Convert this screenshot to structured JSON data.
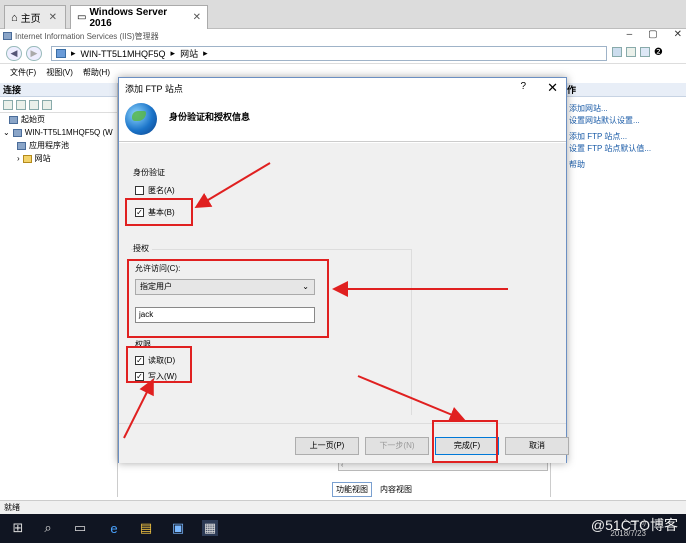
{
  "browser_tabs": [
    {
      "label": "主页",
      "active": false
    },
    {
      "label": "Windows Server 2016",
      "active": true
    }
  ],
  "iis": {
    "window_title": "Internet Information Services (IIS)管理器",
    "path": [
      "WIN-TT5L1MHQF5Q",
      "网站"
    ],
    "menu": [
      "文件(F)",
      "视图(V)",
      "帮助(H)"
    ]
  },
  "connections": {
    "header": "连接",
    "tree": [
      "起始页",
      "WIN-TT5L1MHQF5Q (W",
      "应用程序池",
      "网站"
    ]
  },
  "actions": {
    "header": "作",
    "items": [
      "添加网站...",
      "设置网站默认设置...",
      "添加 FTP 站点...",
      "设置 FTP 站点默认值...",
      "帮助"
    ]
  },
  "view_tabs": [
    "功能视图",
    "内容视图"
  ],
  "status": "就绪",
  "dialog": {
    "title": "添加 FTP 站点",
    "help": "?",
    "close": "✕",
    "heading": "身份验证和授权信息",
    "auth_group": "身份验证",
    "anonymous_label": "匿名(A)",
    "anonymous_checked": false,
    "basic_label": "基本(B)",
    "basic_checked": true,
    "authz_group": "授权",
    "allow_access_label": "允许访问(C):",
    "allow_access_value": "指定用户",
    "user_value": "jack",
    "permissions_group": "权限",
    "read_label": "读取(D)",
    "read_checked": true,
    "write_label": "写入(W)",
    "write_checked": true,
    "btn_prev": "上一页(P)",
    "btn_next": "下一步(N)",
    "btn_finish": "完成(F)",
    "btn_cancel": "取消"
  },
  "taskbar": {
    "time": "2018/7/23"
  },
  "watermark": "@51CTO博客",
  "annotation_color": "#e02020"
}
